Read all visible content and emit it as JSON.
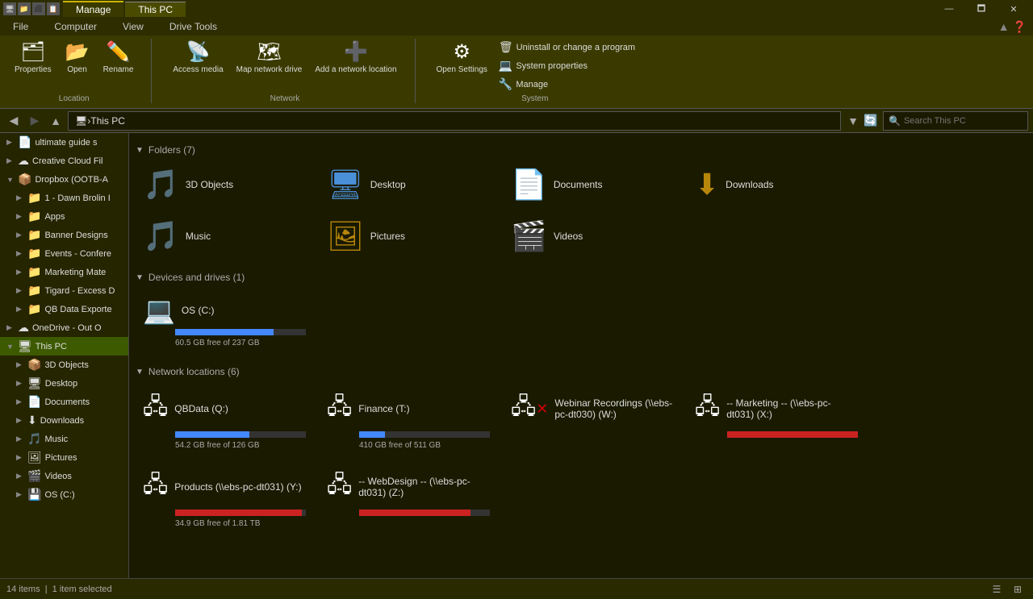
{
  "titleBar": {
    "icons": [
      "🖥",
      "📁",
      "⬜",
      "📋"
    ],
    "tabs": [
      {
        "label": "Manage",
        "active": true
      },
      {
        "label": "This PC",
        "active": false
      }
    ],
    "windowControls": {
      "minimize": "—",
      "maximize": "🗖",
      "close": "✕"
    }
  },
  "ribbon": {
    "tabs": [
      {
        "label": "File",
        "active": false
      },
      {
        "label": "Computer",
        "active": false
      },
      {
        "label": "View",
        "active": false
      },
      {
        "label": "Drive Tools",
        "active": false
      }
    ],
    "groups": [
      {
        "label": "Location",
        "buttons": [
          {
            "icon": "🗂",
            "label": "Properties"
          },
          {
            "icon": "📂",
            "label": "Open"
          },
          {
            "icon": "✏️",
            "label": "Rename"
          }
        ]
      },
      {
        "label": "Network",
        "buttons": [
          {
            "icon": "📡",
            "label": "Access media"
          },
          {
            "icon": "🗺",
            "label": "Map network drive"
          },
          {
            "icon": "➕",
            "label": "Add a network location"
          }
        ]
      },
      {
        "label": "",
        "buttons": [
          {
            "icon": "⚙",
            "label": "Open Settings"
          }
        ],
        "smallButtons": [
          {
            "icon": "🗑",
            "label": "Uninstall or change a program"
          },
          {
            "icon": "💻",
            "label": "System properties"
          },
          {
            "icon": "🔧",
            "label": "Manage"
          }
        ],
        "groupLabel": "System"
      }
    ]
  },
  "addressBar": {
    "pathParts": [
      "🖥",
      "This PC"
    ],
    "searchPlaceholder": "Search This PC"
  },
  "sidebar": {
    "items": [
      {
        "level": 0,
        "label": "ultimate guide s",
        "icon": "📄",
        "arrow": "▶",
        "selected": false
      },
      {
        "level": 0,
        "label": "Creative Cloud Fil",
        "icon": "☁",
        "arrow": "▶",
        "selected": false
      },
      {
        "level": 0,
        "label": "Dropbox (OOTB-A",
        "icon": "📦",
        "arrow": "▼",
        "selected": false
      },
      {
        "level": 1,
        "label": "1 - Dawn Brolin I",
        "icon": "📁",
        "arrow": "▶",
        "selected": false
      },
      {
        "level": 1,
        "label": "Apps",
        "icon": "📁",
        "arrow": "▶",
        "selected": false
      },
      {
        "level": 1,
        "label": "Banner Designs",
        "icon": "📁",
        "arrow": "▶",
        "selected": false
      },
      {
        "level": 1,
        "label": "Events - Confere",
        "icon": "📁",
        "arrow": "▶",
        "selected": false
      },
      {
        "level": 1,
        "label": "Marketing Mate",
        "icon": "📁",
        "arrow": "▶",
        "selected": false
      },
      {
        "level": 1,
        "label": "Tigard - Excess D",
        "icon": "📁",
        "arrow": "▶",
        "selected": false
      },
      {
        "level": 1,
        "label": "QB Data Exporte",
        "icon": "📁",
        "arrow": "▶",
        "selected": false
      },
      {
        "level": 0,
        "label": "OneDrive - Out O",
        "icon": "☁",
        "arrow": "▶",
        "selected": false
      },
      {
        "level": 0,
        "label": "This PC",
        "icon": "🖥",
        "arrow": "▼",
        "selected": true
      },
      {
        "level": 1,
        "label": "3D Objects",
        "icon": "📦",
        "arrow": "▶",
        "selected": false
      },
      {
        "level": 1,
        "label": "Desktop",
        "icon": "🖥",
        "arrow": "▶",
        "selected": false
      },
      {
        "level": 1,
        "label": "Documents",
        "icon": "📄",
        "arrow": "▶",
        "selected": false
      },
      {
        "level": 1,
        "label": "Downloads",
        "icon": "⬇",
        "arrow": "▶",
        "selected": false
      },
      {
        "level": 1,
        "label": "Music",
        "icon": "🎵",
        "arrow": "▶",
        "selected": false
      },
      {
        "level": 1,
        "label": "Pictures",
        "icon": "🖼",
        "arrow": "▶",
        "selected": false
      },
      {
        "level": 1,
        "label": "Videos",
        "icon": "🎬",
        "arrow": "▶",
        "selected": false
      },
      {
        "level": 1,
        "label": "OS (C:)",
        "icon": "💾",
        "arrow": "▶",
        "selected": false
      }
    ]
  },
  "content": {
    "sections": {
      "folders": {
        "title": "Folders (7)",
        "items": [
          {
            "icon": "🎵",
            "name": "3D Objects",
            "color": "#b8860b"
          },
          {
            "icon": "🖥",
            "name": "Desktop",
            "color": "#4a90d9"
          },
          {
            "icon": "📄",
            "name": "Documents",
            "color": "#b8860b"
          },
          {
            "icon": "⬇",
            "name": "Downloads",
            "color": "#b8860b"
          },
          {
            "icon": "🎵",
            "name": "Music",
            "color": "#b8860b"
          },
          {
            "icon": "🖼",
            "name": "Pictures",
            "color": "#b8860b"
          },
          {
            "icon": "🎬",
            "name": "Videos",
            "color": "#b8860b"
          }
        ]
      },
      "devices": {
        "title": "Devices and drives (1)",
        "items": [
          {
            "icon": "💻",
            "name": "OS (C:)",
            "freeSpace": "60.5 GB free of 237 GB",
            "usedPct": 75,
            "barColor": "blue"
          }
        ]
      },
      "network": {
        "title": "Network locations (6)",
        "items": [
          {
            "icon": "🖧",
            "name": "QBData (Q:)",
            "freeSpace": "54.2 GB free of 126 GB",
            "usedPct": 57,
            "barColor": "blue",
            "disconnected": false
          },
          {
            "icon": "🖧",
            "name": "Finance (T:)",
            "freeSpace": "410 GB free of 511 GB",
            "usedPct": 20,
            "barColor": "blue",
            "disconnected": false
          },
          {
            "icon": "🖧",
            "name": "Webinar Recordings (\\\\ebs-pc-dt030) (W:)",
            "freeSpace": "",
            "usedPct": 0,
            "barColor": "red",
            "disconnected": true
          },
          {
            "icon": "🖧",
            "name": "-- Marketing -- (\\\\ebs-pc-dt031) (X:)",
            "freeSpace": "",
            "usedPct": 100,
            "barColor": "red",
            "disconnected": false
          },
          {
            "icon": "🖧",
            "name": "Products (\\\\ebs-pc-dt031) (Y:)",
            "freeSpace": "34.9 GB free of 1.81 TB",
            "usedPct": 97,
            "barColor": "red",
            "disconnected": false
          },
          {
            "icon": "🖧",
            "name": "-- WebDesign -- (\\\\ebs-pc-dt031) (Z:)",
            "freeSpace": "",
            "usedPct": 85,
            "barColor": "red",
            "disconnected": false
          }
        ]
      }
    }
  },
  "statusBar": {
    "itemCount": "14 items",
    "selectedCount": "1 item selected"
  }
}
